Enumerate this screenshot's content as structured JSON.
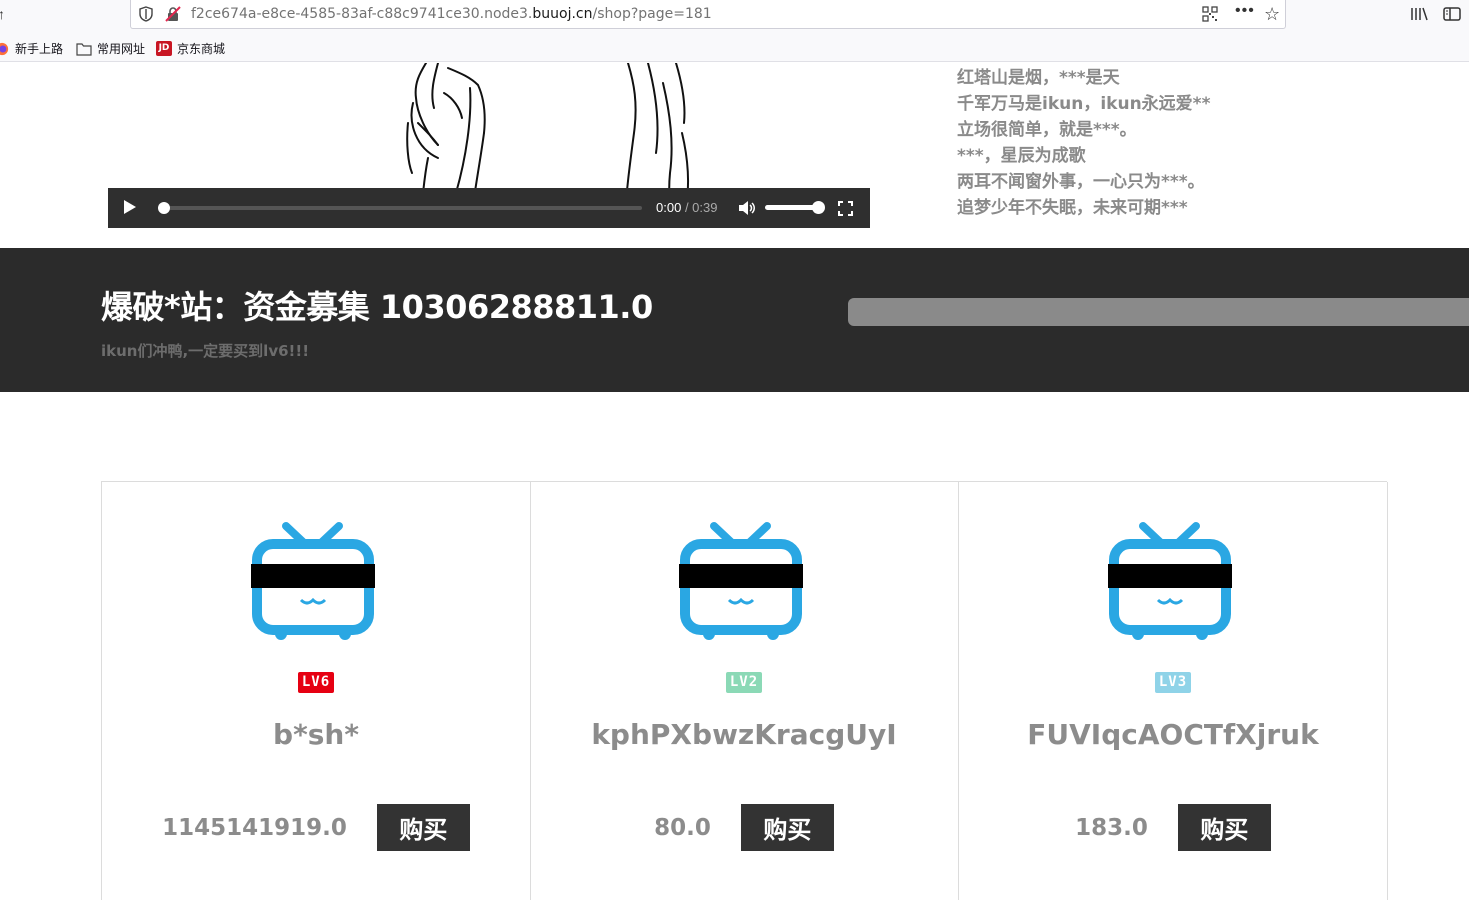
{
  "browser": {
    "url_host_prefix": "f2ce674a-e8ce-4585-83af-c88c9741ce30.node3.",
    "url_host_domain": "buuoj.cn",
    "url_path": "/shop?page=181",
    "bookmarks": [
      {
        "label": "新手上路",
        "icon": "firefox-icon"
      },
      {
        "label": "常用网址",
        "icon": "folder-icon"
      },
      {
        "label": "京东商城",
        "icon": "jd-icon",
        "badge": "JD"
      }
    ]
  },
  "video": {
    "current_time": "0:00",
    "duration": "/ 0:39",
    "progress": 0,
    "volume": 1.0
  },
  "lyrics": [
    "红塔山是烟，***是天",
    "千军万马是ikun，ikun永远爱**",
    "立场很简单，就是***。",
    "***，星辰为成歌",
    "两耳不闻窗外事，一心只为***。",
    "追梦少年不失眠，未来可期***"
  ],
  "banner": {
    "title": "爆破*站：资金募集 10306288811.0",
    "subtitle": "ikun们冲鸭,一定要买到lv6!!!"
  },
  "products": [
    {
      "level": "LV6",
      "level_color": "#e60012",
      "name": "b*sh*",
      "price": "1145141919.0",
      "buy_label": "购买"
    },
    {
      "level": "LV2",
      "level_color": "#8bd9b6",
      "name": "kphPXbwzKracgUyI",
      "price": "80.0",
      "buy_label": "购买"
    },
    {
      "level": "LV3",
      "level_color": "#8fd3e8",
      "name": "FUVIqcAOCTfXjruk",
      "price": "183.0",
      "buy_label": "购买"
    }
  ],
  "colors": {
    "tv_blue": "#2aa7e3",
    "banner_bg": "#2b2b2b",
    "buy_bg": "#333333"
  }
}
